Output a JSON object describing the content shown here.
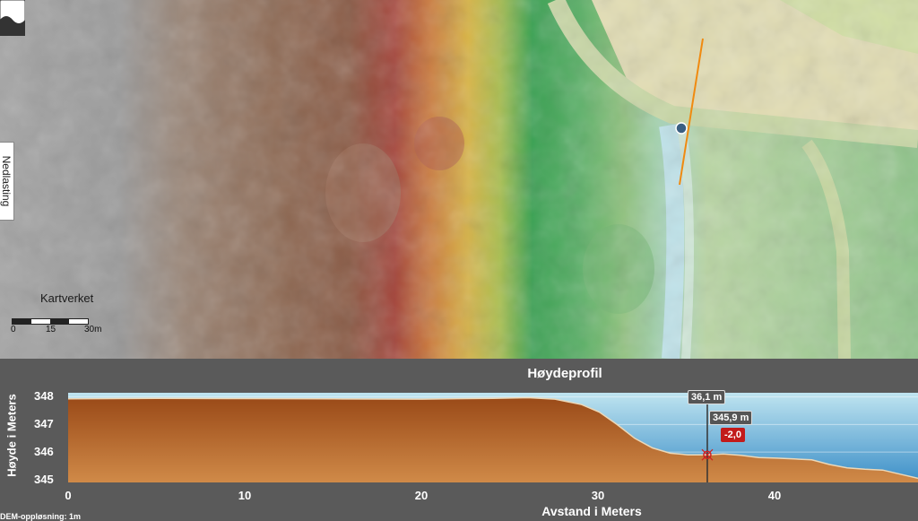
{
  "map": {
    "side_tab_label": "Nedlasting",
    "logo_label": "Kartverket",
    "scale_labels": [
      "0",
      "15",
      "30m"
    ]
  },
  "profile": {
    "title": "Høydeprofil",
    "y_axis_label": "Høyde i Meters",
    "x_axis_label": "Avstand i Meters",
    "dem_resolution": "DEM-oppløsning: 1m",
    "cursor": {
      "distance_label": "36,1 m",
      "height_label": "345,9 m",
      "delta_label": "-2,0"
    }
  },
  "chart_data": {
    "type": "area",
    "xlabel": "Avstand i Meters",
    "ylabel": "Høyde i Meters",
    "xlim": [
      0,
      48
    ],
    "ylim": [
      344.9,
      348.15
    ],
    "xticks": [
      0,
      10,
      20,
      30,
      40
    ],
    "yticks": [
      345,
      346,
      347,
      348
    ],
    "x": [
      0,
      5,
      10,
      15,
      20,
      24,
      26,
      27.5,
      29,
      30,
      31,
      32,
      33,
      34,
      35,
      36.1,
      37,
      38,
      39,
      40,
      41,
      42,
      43,
      44,
      45,
      46,
      47,
      48
    ],
    "y": [
      347.93,
      347.95,
      347.94,
      347.93,
      347.92,
      347.95,
      347.97,
      347.92,
      347.72,
      347.45,
      347.0,
      346.5,
      346.15,
      345.96,
      345.9,
      345.9,
      345.93,
      345.88,
      345.8,
      345.78,
      345.75,
      345.72,
      345.55,
      345.43,
      345.38,
      345.35,
      345.2,
      345.05
    ],
    "cursor": {
      "x": 36.1,
      "y": 345.9
    },
    "colors": {
      "terrain": "#b8642a",
      "sky_top": "#bfe4f0",
      "sky_bottom": "#3c8fc8",
      "cursor": "#d02020"
    }
  },
  "colors": {
    "panel_bg": "#5a5a5a",
    "profile_line": "#f08a10"
  }
}
